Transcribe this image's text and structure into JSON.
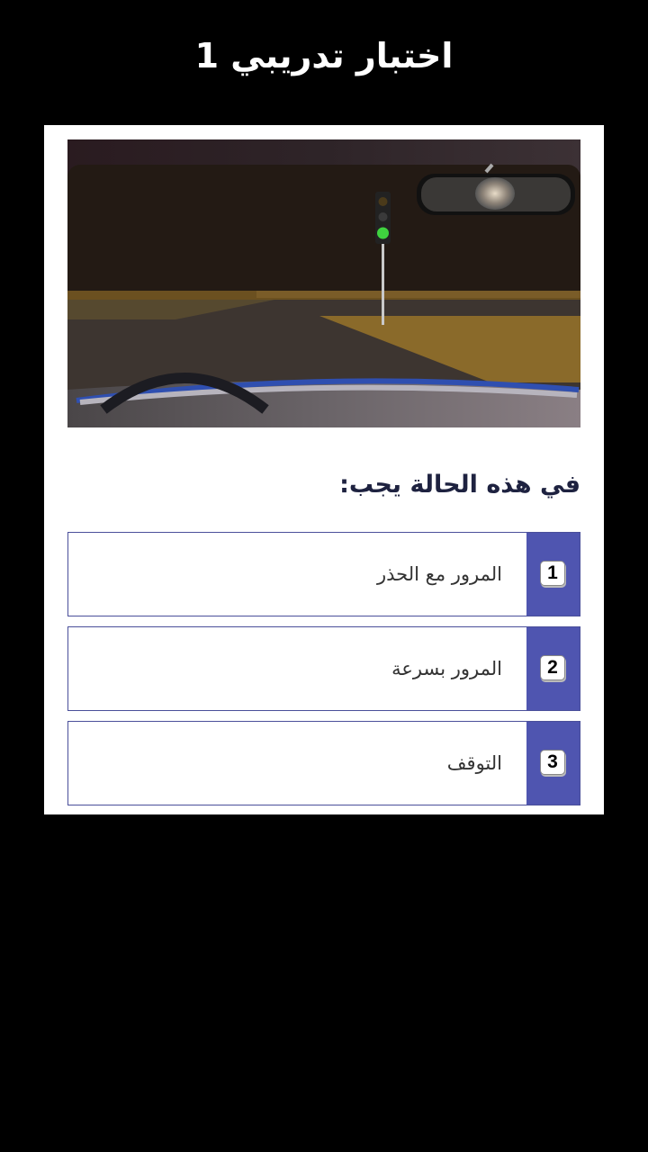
{
  "header": {
    "title": "اختبار تدريبي 1"
  },
  "question": {
    "text": "في هذه الحالة يجب:"
  },
  "answers": [
    {
      "number": "1",
      "label": "المرور مع الحذر"
    },
    {
      "number": "2",
      "label": "المرور بسرعة"
    },
    {
      "number": "3",
      "label": "التوقف"
    }
  ],
  "scene": {
    "description_icon": "traffic-light-green-icon",
    "light_color": "#3fd33f"
  }
}
